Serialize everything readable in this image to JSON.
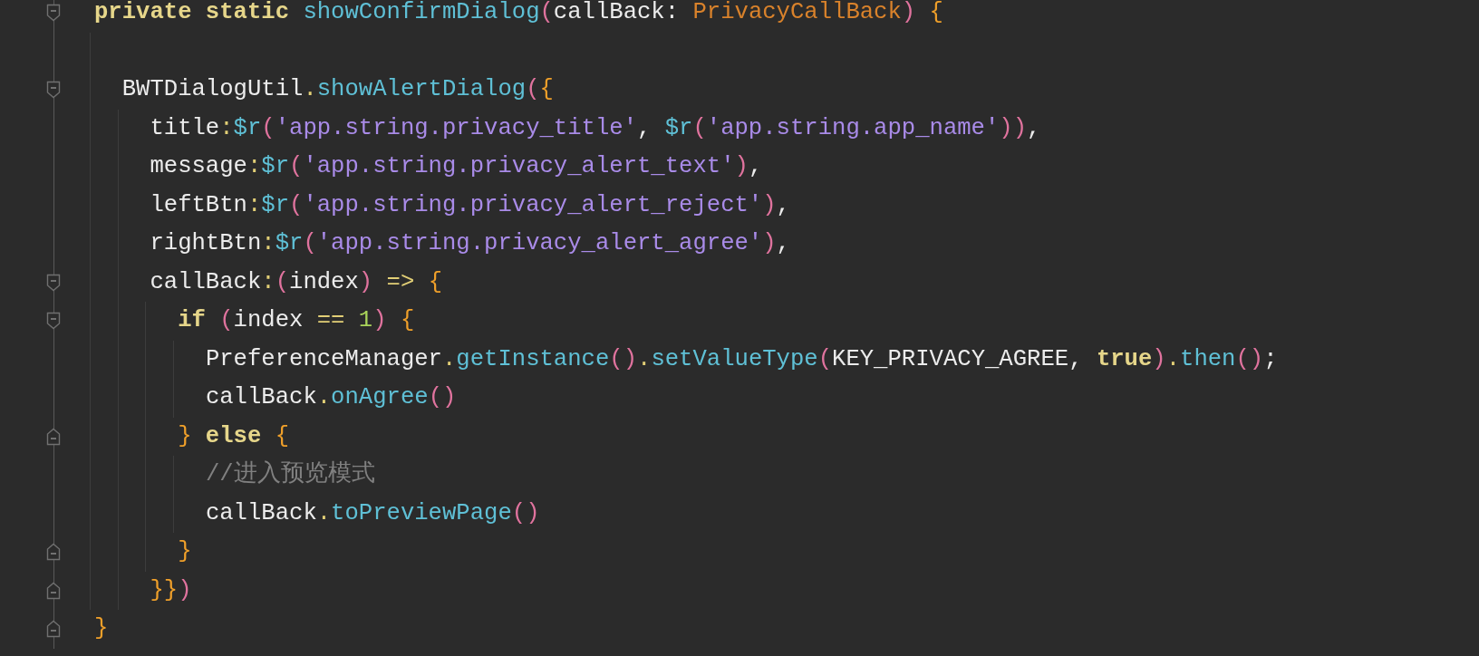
{
  "editor": {
    "lines": [
      {
        "kind": "block-start",
        "tokens": [
          {
            "kind": "keyword",
            "text": "private static "
          },
          {
            "kind": "func",
            "text": "showConfirmDialog"
          },
          {
            "kind": "paren",
            "text": "("
          },
          {
            "kind": "plain",
            "text": "callBack: "
          },
          {
            "kind": "type",
            "text": "PrivacyCallBack"
          },
          {
            "kind": "paren",
            "text": ") "
          },
          {
            "kind": "brace",
            "text": "{"
          }
        ]
      },
      {
        "kind": "blank"
      },
      {
        "kind": "block-start",
        "tokens": [
          {
            "kind": "plain",
            "text": "  BWTDialogUtil"
          },
          {
            "kind": "op",
            "text": "."
          },
          {
            "kind": "func",
            "text": "showAlertDialog"
          },
          {
            "kind": "paren",
            "text": "("
          },
          {
            "kind": "brace",
            "text": "{"
          }
        ]
      },
      {
        "tokens": [
          {
            "kind": "plain",
            "text": "    title"
          },
          {
            "kind": "op",
            "text": ":"
          },
          {
            "kind": "func",
            "text": "$r"
          },
          {
            "kind": "paren",
            "text": "("
          },
          {
            "kind": "string",
            "text": "'app.string.privacy_title'"
          },
          {
            "kind": "plain",
            "text": ", "
          },
          {
            "kind": "func",
            "text": "$r"
          },
          {
            "kind": "paren",
            "text": "("
          },
          {
            "kind": "string",
            "text": "'app.string.app_name'"
          },
          {
            "kind": "paren",
            "text": "))"
          },
          {
            "kind": "plain",
            "text": ","
          }
        ]
      },
      {
        "tokens": [
          {
            "kind": "plain",
            "text": "    message"
          },
          {
            "kind": "op",
            "text": ":"
          },
          {
            "kind": "func",
            "text": "$r"
          },
          {
            "kind": "paren",
            "text": "("
          },
          {
            "kind": "string",
            "text": "'app.string.privacy_alert_text'"
          },
          {
            "kind": "paren",
            "text": ")"
          },
          {
            "kind": "plain",
            "text": ","
          }
        ]
      },
      {
        "tokens": [
          {
            "kind": "plain",
            "text": "    leftBtn"
          },
          {
            "kind": "op",
            "text": ":"
          },
          {
            "kind": "func",
            "text": "$r"
          },
          {
            "kind": "paren",
            "text": "("
          },
          {
            "kind": "string",
            "text": "'app.string.privacy_alert_reject'"
          },
          {
            "kind": "paren",
            "text": ")"
          },
          {
            "kind": "plain",
            "text": ","
          }
        ]
      },
      {
        "tokens": [
          {
            "kind": "plain",
            "text": "    rightBtn"
          },
          {
            "kind": "op",
            "text": ":"
          },
          {
            "kind": "func",
            "text": "$r"
          },
          {
            "kind": "paren",
            "text": "("
          },
          {
            "kind": "string",
            "text": "'app.string.privacy_alert_agree'"
          },
          {
            "kind": "paren",
            "text": ")"
          },
          {
            "kind": "plain",
            "text": ","
          }
        ]
      },
      {
        "kind": "block-start",
        "tokens": [
          {
            "kind": "plain",
            "text": "    callBack"
          },
          {
            "kind": "op",
            "text": ":"
          },
          {
            "kind": "paren",
            "text": "("
          },
          {
            "kind": "plain",
            "text": "index"
          },
          {
            "kind": "paren",
            "text": ")"
          },
          {
            "kind": "op",
            "text": " => "
          },
          {
            "kind": "brace",
            "text": "{"
          }
        ]
      },
      {
        "kind": "block-start",
        "tokens": [
          {
            "kind": "keyword",
            "text": "      if"
          },
          {
            "kind": "paren",
            "text": " ("
          },
          {
            "kind": "plain",
            "text": "index"
          },
          {
            "kind": "op",
            "text": " == "
          },
          {
            "kind": "number",
            "text": "1"
          },
          {
            "kind": "paren",
            "text": ") "
          },
          {
            "kind": "brace",
            "text": "{"
          }
        ]
      },
      {
        "tokens": [
          {
            "kind": "plain",
            "text": "        PreferenceManager"
          },
          {
            "kind": "op",
            "text": "."
          },
          {
            "kind": "func",
            "text": "getInstance"
          },
          {
            "kind": "paren",
            "text": "()"
          },
          {
            "kind": "op",
            "text": "."
          },
          {
            "kind": "func",
            "text": "setValueType"
          },
          {
            "kind": "paren",
            "text": "("
          },
          {
            "kind": "plain",
            "text": "KEY_PRIVACY_AGREE, "
          },
          {
            "kind": "keyword",
            "text": "true"
          },
          {
            "kind": "paren",
            "text": ")"
          },
          {
            "kind": "op",
            "text": "."
          },
          {
            "kind": "func",
            "text": "then"
          },
          {
            "kind": "paren",
            "text": "()"
          },
          {
            "kind": "plain",
            "text": ";"
          }
        ]
      },
      {
        "tokens": [
          {
            "kind": "plain",
            "text": "        callBack"
          },
          {
            "kind": "op",
            "text": "."
          },
          {
            "kind": "func",
            "text": "onAgree"
          },
          {
            "kind": "paren",
            "text": "()"
          }
        ]
      },
      {
        "kind": "block-end",
        "tokens": [
          {
            "kind": "brace",
            "text": "      }"
          },
          {
            "kind": "keyword",
            "text": " else "
          },
          {
            "kind": "brace",
            "text": "{"
          }
        ]
      },
      {
        "tokens": [
          {
            "kind": "comment",
            "text": "        //进入预览模式"
          }
        ]
      },
      {
        "tokens": [
          {
            "kind": "plain",
            "text": "        callBack"
          },
          {
            "kind": "op",
            "text": "."
          },
          {
            "kind": "func",
            "text": "toPreviewPage"
          },
          {
            "kind": "paren",
            "text": "()"
          }
        ]
      },
      {
        "kind": "block-end",
        "tokens": [
          {
            "kind": "brace",
            "text": "      }"
          }
        ]
      },
      {
        "kind": "block-end",
        "tokens": [
          {
            "kind": "brace",
            "text": "    }}"
          },
          {
            "kind": "paren",
            "text": ")"
          }
        ]
      },
      {
        "kind": "block-end",
        "tokens": [
          {
            "kind": "brace",
            "text": "}"
          }
        ]
      }
    ]
  }
}
